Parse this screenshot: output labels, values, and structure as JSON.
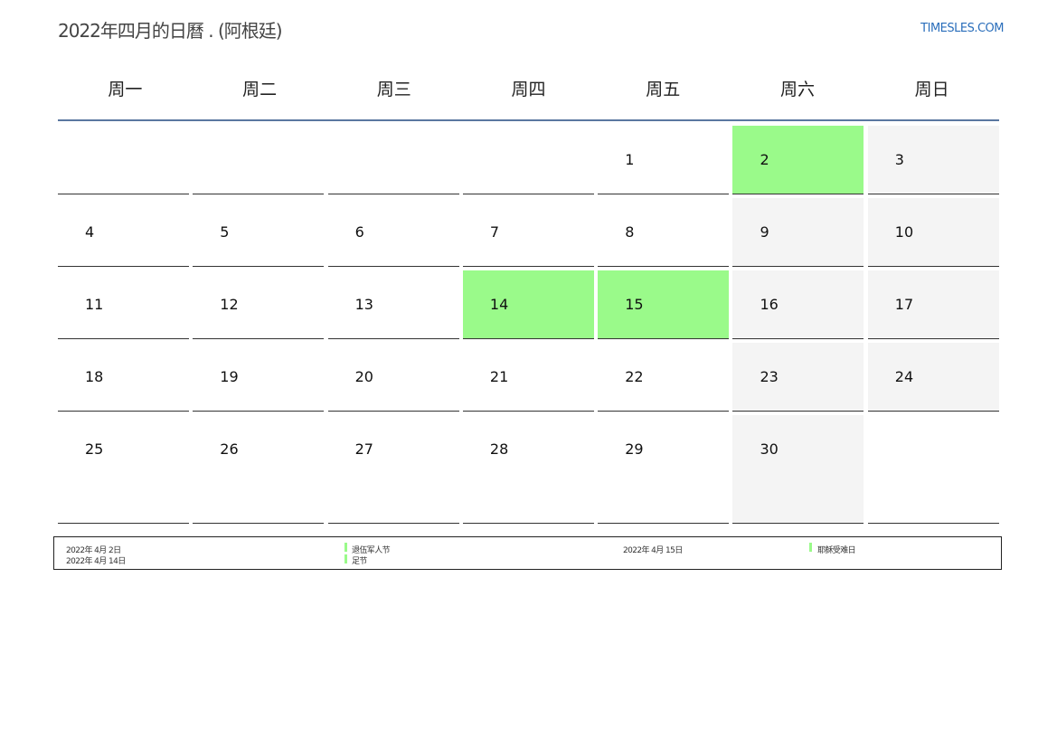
{
  "header": {
    "title": "2022年四月的日曆 . (阿根廷)",
    "site": "TIMESLES.COM"
  },
  "weekdays": [
    "周一",
    "周二",
    "周三",
    "周四",
    "周五",
    "周六",
    "周日"
  ],
  "weeks": [
    [
      "",
      "",
      "",
      "",
      "1",
      "2",
      "3"
    ],
    [
      "4",
      "5",
      "6",
      "7",
      "8",
      "9",
      "10"
    ],
    [
      "11",
      "12",
      "13",
      "14",
      "15",
      "16",
      "17"
    ],
    [
      "18",
      "19",
      "20",
      "21",
      "22",
      "23",
      "24"
    ],
    [
      "25",
      "26",
      "27",
      "28",
      "29",
      "30",
      ""
    ]
  ],
  "holiday_days": [
    "2",
    "14",
    "15"
  ],
  "colors": {
    "holiday": "#9afa8a",
    "weekend": "#f4f4f4",
    "header_rule": "#5a77a0",
    "link": "#2a6ebb"
  },
  "legend": {
    "entries": [
      {
        "date": "2022年 4月 2日",
        "name": "退伍军人节"
      },
      {
        "date": "2022年 4月 14日",
        "name": "足节"
      },
      {
        "date": "2022年 4月 15日",
        "name": "耶稣受难日"
      }
    ]
  }
}
